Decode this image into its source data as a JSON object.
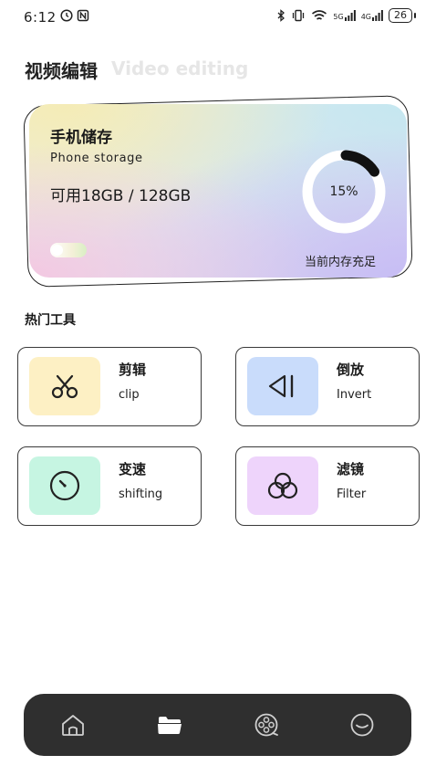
{
  "status_bar": {
    "time": "6:12",
    "network_5g": "5G",
    "network_4g": "4G",
    "battery": "26"
  },
  "header": {
    "title_cn": "视频编辑",
    "title_en": "Video editing"
  },
  "storage": {
    "title": "手机储存",
    "subtitle": "Phone  storage",
    "available": "可用18GB / 128GB",
    "percent_label": "15%",
    "percent_value": 0.15,
    "status": "当前内存充足"
  },
  "tools": {
    "section_title": "热门工具",
    "items": [
      {
        "name": "剪辑",
        "en": "clip",
        "icon": "scissors-icon",
        "color": "#fdf0c4"
      },
      {
        "name": "倒放",
        "en": "Invert",
        "icon": "rewind-icon",
        "color": "#c9dcfb"
      },
      {
        "name": "变速",
        "en": "shifting",
        "icon": "speed-gauge-icon",
        "color": "#c6f5e2"
      },
      {
        "name": "滤镜",
        "en": "Filter",
        "icon": "filter-icon",
        "color": "#eed4fb"
      }
    ]
  },
  "bottom_nav": {
    "items": [
      {
        "icon": "home-icon"
      },
      {
        "icon": "folder-icon",
        "active": true
      },
      {
        "icon": "film-reel-icon"
      },
      {
        "icon": "profile-face-icon"
      }
    ]
  },
  "colors": {
    "nav_background": "#2f2f2f",
    "ring_progress": "#111111",
    "ring_track": "#ffffff"
  }
}
